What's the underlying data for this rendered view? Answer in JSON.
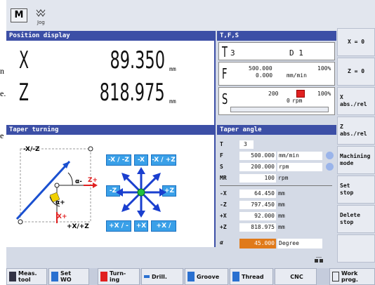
{
  "bleed": {
    "line1": "n",
    "line2": "e.",
    "line3": "e"
  },
  "topbar": {
    "mode_label": "M",
    "jog_label": "Jog"
  },
  "position_display": {
    "title": "Position display",
    "x": {
      "axis": "X",
      "value": "89.350",
      "unit": "mm"
    },
    "z": {
      "axis": "Z",
      "value": "818.975",
      "unit": "mm"
    }
  },
  "tfs": {
    "title": "T,F,S",
    "t": {
      "letter": "T",
      "tool": "3",
      "edge": "D 1"
    },
    "f": {
      "letter": "F",
      "value": "500.000",
      "actual": "0.000",
      "override": "100%",
      "unit": "mm/min"
    },
    "s": {
      "letter": "S",
      "value": "200",
      "actual": "0",
      "override": "100%",
      "unit": "rpm"
    }
  },
  "softkeys_right": [
    "X = 0",
    "Z = 0",
    "X\nabs./rel",
    "Z\nabs./rel",
    "Machining\nmode",
    "Set\nstop",
    "Delete\nstop",
    ""
  ],
  "taper_turning": {
    "title": "Taper turning",
    "label_xz": "-X/-Z",
    "label_alpha_minus": "α-",
    "label_alpha_plus": "α+",
    "label_z_plus": "Z+",
    "label_x_plus": "X+",
    "label_xz_plus": "+X/+Z",
    "btn_mx_mz": "-X / -Z",
    "btn_mx": "-X",
    "btn_mx_pz": "-X / +Z",
    "btn_mz": "-Z",
    "btn_pz": "+Z",
    "btn_px_mz": "+X / -Z",
    "btn_px": "+X",
    "btn_px_pz": "+X / +Z"
  },
  "taper_angle": {
    "title": "Taper angle",
    "rows": [
      {
        "label": "T",
        "value": "3",
        "unit": ""
      },
      {
        "label": "F",
        "value": "500.000",
        "unit": "mm/min"
      },
      {
        "label": "S",
        "value": "200.000",
        "unit": "rpm"
      },
      {
        "label": "MR",
        "value": "100",
        "unit": "rpm"
      },
      {
        "label": "-X",
        "value": "64.450",
        "unit": "mm"
      },
      {
        "label": "-Z",
        "value": "797.450",
        "unit": "mm"
      },
      {
        "label": "+X",
        "value": "92.000",
        "unit": "mm"
      },
      {
        "label": "+Z",
        "value": "818.975",
        "unit": "mm"
      },
      {
        "label": "α",
        "value": "45.000",
        "unit": "Degree"
      }
    ]
  },
  "bottom_softkeys": {
    "meas": "Meas.\ntool",
    "set": "Set\nWO",
    "turning": "Turn-\ning",
    "drill": "Drill.",
    "groove": "Groove",
    "thread": "Thread",
    "cnc": "CNC",
    "work": "Work\nprog."
  },
  "colors": {
    "header": "#3c4fa6",
    "dirbtn": "#3aa0e8",
    "alpha": "#e07a1a"
  }
}
